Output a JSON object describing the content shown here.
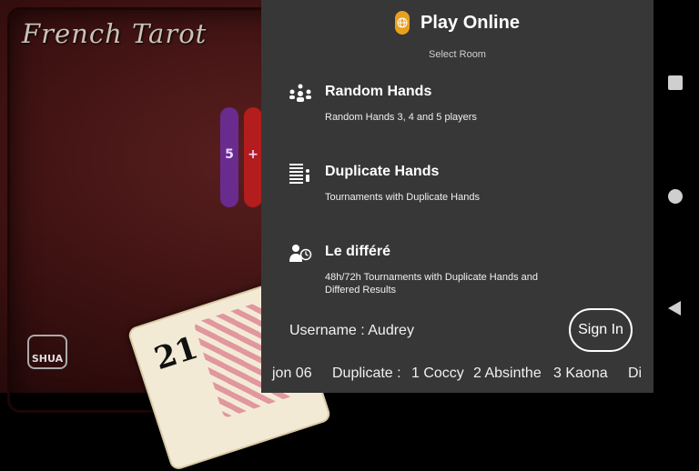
{
  "background": {
    "game_title": "French Tarot",
    "chip_purple_label": "5",
    "chip_red_label": "+",
    "card_number": "21",
    "logo_text": "SHUA"
  },
  "panel": {
    "title": "Play Online",
    "subtitle": "Select Room",
    "items": [
      {
        "icon": "random-hands-icon",
        "title": "Random Hands",
        "desc": "Random Hands 3, 4 and 5 players"
      },
      {
        "icon": "duplicate-hands-icon",
        "title": "Duplicate Hands",
        "desc": "Tournaments with Duplicate Hands"
      },
      {
        "icon": "deferred-icon",
        "title": "Le différé",
        "desc": "48h/72h Tournaments with Duplicate Hands and Differed Results"
      }
    ],
    "username": "Username : Audrey",
    "sign_in": "Sign In",
    "ticker": {
      "part1": "jon 06",
      "part2": "Duplicate :",
      "part3": "1 Coccy",
      "part4": "2 Absinthe",
      "part5": "3 Kaona",
      "part6": "Di"
    }
  },
  "colors": {
    "panel_bg": "#373737",
    "accent": "#e8a020",
    "table_bg": "#3a1010"
  }
}
